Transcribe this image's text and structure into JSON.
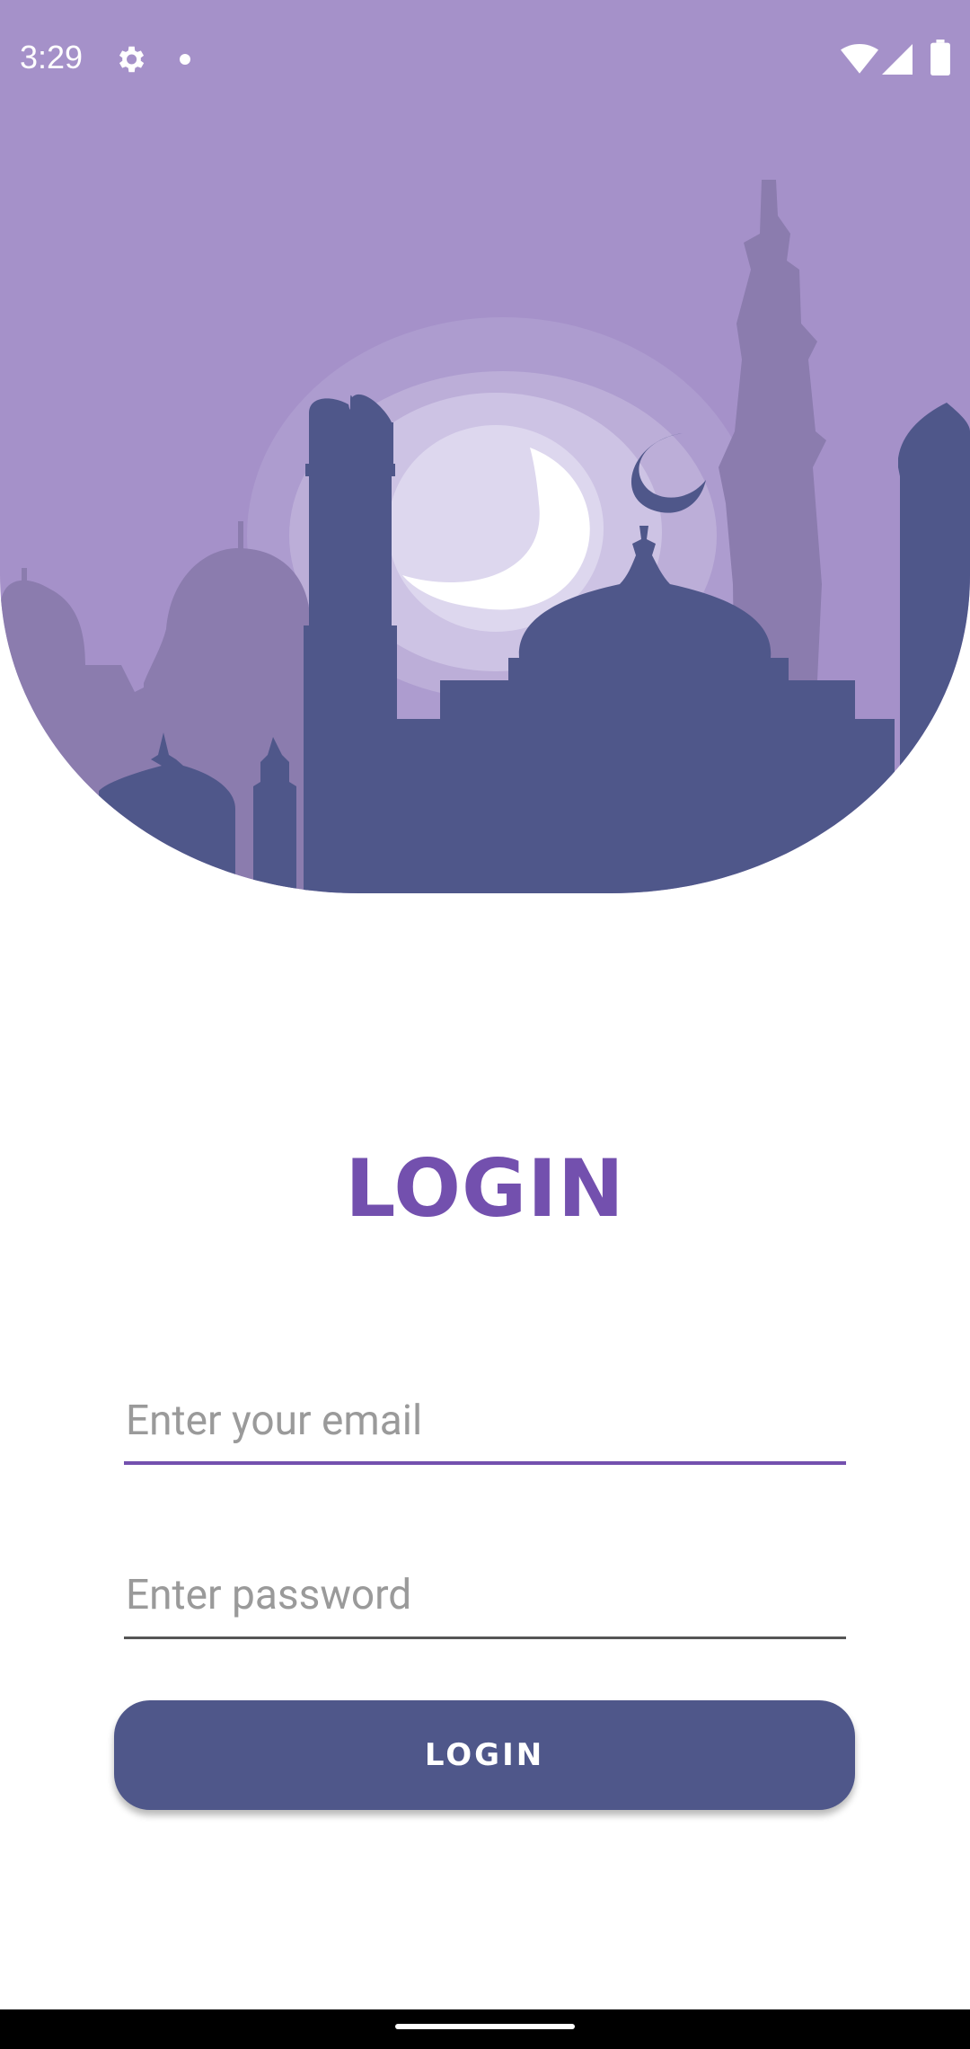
{
  "status_bar": {
    "time": "3:29",
    "icons": [
      "gear-icon",
      "notification-dot-icon",
      "wifi-icon",
      "signal-icon",
      "battery-icon"
    ]
  },
  "hero": {
    "illustration": "mosque-silhouette-with-crescent-moon",
    "colors": {
      "sky": "#a591c9",
      "mosque": "#4f578a",
      "back_mosques": "#8b7cae",
      "moon": "#ffffff"
    }
  },
  "login": {
    "title": "LOGIN",
    "email_placeholder": "Enter your email",
    "password_placeholder": "Enter password",
    "button_label": "LOGIN"
  },
  "colors": {
    "accent": "#7350ae",
    "button": "#4f578a"
  }
}
